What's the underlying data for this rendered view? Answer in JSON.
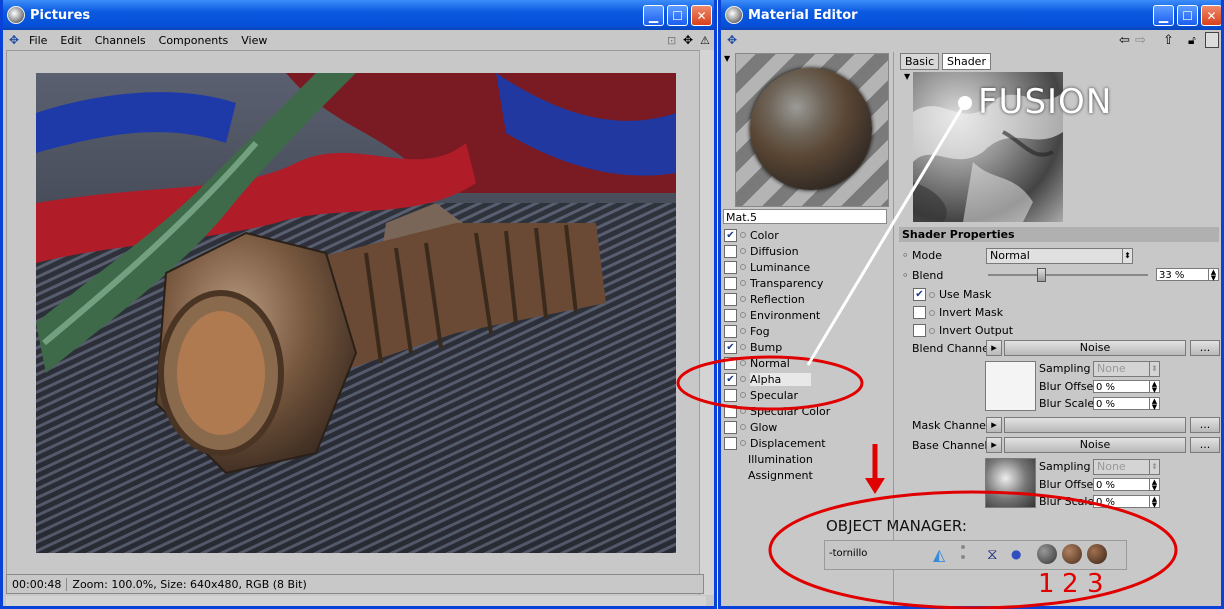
{
  "pictures": {
    "title": "Pictures",
    "menu": [
      "File",
      "Edit",
      "Channels",
      "Components",
      "View"
    ],
    "status": {
      "time": "00:00:48",
      "info": "Zoom: 100.0%, Size: 640x480, RGB (8 Bit)"
    }
  },
  "material_editor": {
    "title": "Material Editor",
    "material_name": "Mat.5",
    "channels": [
      {
        "label": "Color",
        "checked": true
      },
      {
        "label": "Diffusion",
        "checked": false
      },
      {
        "label": "Luminance",
        "checked": false
      },
      {
        "label": "Transparency",
        "checked": false
      },
      {
        "label": "Reflection",
        "checked": false
      },
      {
        "label": "Environment",
        "checked": false
      },
      {
        "label": "Fog",
        "checked": false
      },
      {
        "label": "Bump",
        "checked": true
      },
      {
        "label": "Normal",
        "checked": false
      },
      {
        "label": "Alpha",
        "checked": true
      },
      {
        "label": "Specular",
        "checked": false
      },
      {
        "label": "Specular Color",
        "checked": false
      },
      {
        "label": "Glow",
        "checked": false
      },
      {
        "label": "Displacement",
        "checked": false
      },
      {
        "label": "Illumination",
        "checked": null
      },
      {
        "label": "Assignment",
        "checked": null
      }
    ],
    "tabs": [
      "Basic",
      "Shader"
    ],
    "shader_label": "FUSION",
    "section": "Shader Properties",
    "mode_label": "Mode",
    "mode_value": "Normal",
    "blend_label": "Blend",
    "blend_value": "33 %",
    "blend_fraction": 0.33,
    "use_mask": "Use Mask",
    "invert_mask": "Invert Mask",
    "invert_output": "Invert Output",
    "blend_channel_label": "Blend Channel",
    "blend_channel_value": "Noise",
    "mask_channel_label": "Mask Channel",
    "base_channel_label": "Base Channel",
    "base_channel_value": "Noise",
    "more_button": "...",
    "sampling_label": "Sampling",
    "sampling_value": "None",
    "blur_offset_label": "Blur Offset",
    "blur_offset_value": "0 %",
    "blur_scale_label": "Blur Scale",
    "blur_scale_value": "0 %"
  },
  "annotations": {
    "object_manager_title": "OBJECT MANAGER:",
    "object_name": "tornillo",
    "numbers": [
      "1",
      "2",
      "3"
    ]
  },
  "colors": {
    "annotation_red": "#e00000",
    "xp_blue": "#0a5ae0"
  }
}
